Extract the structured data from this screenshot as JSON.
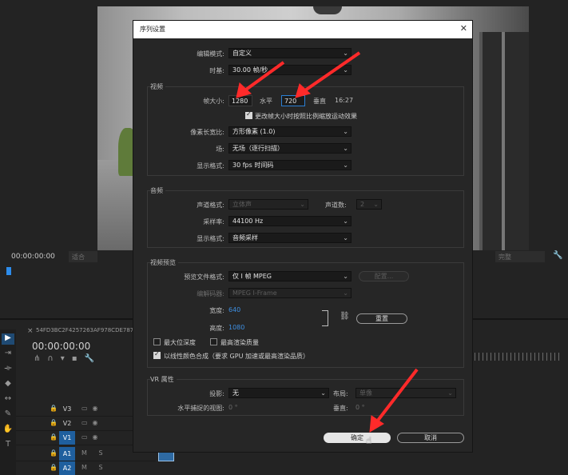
{
  "background": {
    "source_timecode": "00:00:00:00",
    "source_fit": "适合",
    "program_fit": "完整",
    "timeline_tab": "54FD3BC2F4257263AF978CDE787",
    "timeline_timecode": "00:00:00:00",
    "tracks": [
      {
        "label": "V3",
        "highlight": false
      },
      {
        "label": "V2",
        "highlight": false
      },
      {
        "label": "V1",
        "highlight": true
      },
      {
        "label": "A1",
        "highlight": true,
        "extra": "M  S"
      },
      {
        "label": "A2",
        "highlight": true,
        "extra": "M  S"
      }
    ]
  },
  "dialog": {
    "title": "序列设置",
    "edit_mode_label": "编辑模式:",
    "edit_mode_value": "自定义",
    "timebase_label": "时基:",
    "timebase_value": "30.00  帧/秒",
    "video": {
      "section": "视频",
      "frame_size_label": "帧大小:",
      "width": "1280",
      "horizontal_label": "水平",
      "height": "720",
      "vertical_label": "垂直",
      "ratio": "16:27",
      "scale_checkbox_label": "更改帧大小时按照比例缩放运动效果",
      "pixel_aspect_label": "像素长宽比:",
      "pixel_aspect_value": "方形像素 (1.0)",
      "fields_label": "场:",
      "fields_value": "无场（逐行扫描）",
      "display_format_label": "显示格式:",
      "display_format_value": "30 fps 时间码"
    },
    "audio": {
      "section": "音频",
      "channel_format_label": "声道格式:",
      "channel_format_value": "立体声",
      "channels_label": "声道数:",
      "channels_value": "2",
      "sample_rate_label": "采样率:",
      "sample_rate_value": "44100 Hz",
      "display_format_label": "显示格式:",
      "display_format_value": "音频采样"
    },
    "preview": {
      "section": "视频预览",
      "file_format_label": "预览文件格式:",
      "file_format_value": "仅 I 帧 MPEG",
      "configure_button": "配置...",
      "codec_label": "编解码器:",
      "codec_value": "MPEG I-Frame",
      "width_label": "宽度:",
      "width_value": "640",
      "height_label": "高度:",
      "height_value": "1080",
      "reset_button": "重置",
      "max_bit_depth": "最大位深度",
      "max_render_quality": "最高渲染质量",
      "linear_color": "以线性颜色合成（要求 GPU 加速或最高渲染品质）"
    },
    "vr": {
      "section": "VR 属性",
      "projection_label": "投影:",
      "projection_value": "无",
      "layout_label": "布局:",
      "layout_value": "单像",
      "h_fov_label": "水平捕捉的视图:",
      "h_fov_value": "0 °",
      "v_label": "垂直:",
      "v_value": "0 °"
    },
    "ok_button": "确定",
    "cancel_button": "取消"
  },
  "colors": {
    "accent_blue": "#3e8ee0",
    "annotation_red": "#ff2a2a"
  }
}
